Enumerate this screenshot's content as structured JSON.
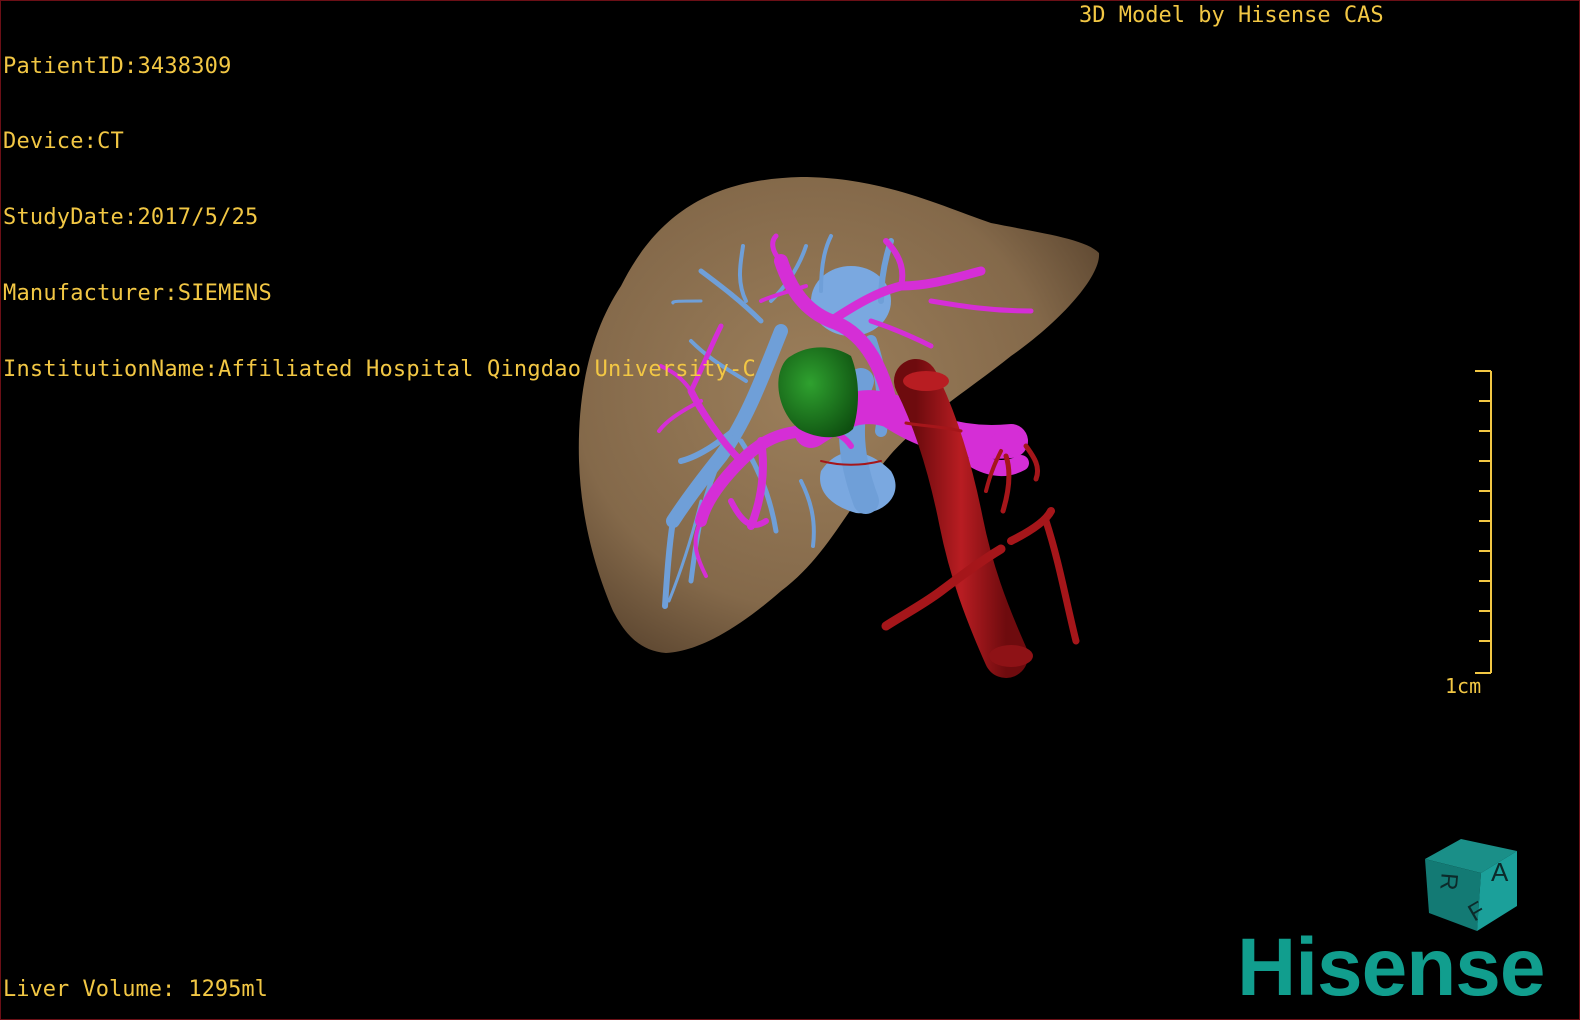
{
  "overlay": {
    "patient_id": "PatientID:3438309",
    "device": "Device:CT",
    "study_date": "StudyDate:2017/5/25",
    "manufacturer": "Manufacturer:SIEMENS",
    "institution": "InstitutionName:Affiliated Hospital Qingdao University-C"
  },
  "header": {
    "brand_label": "3D Model by Hisense CAS"
  },
  "footer": {
    "liver_volume": "Liver Volume: 1295ml"
  },
  "scale_bar": {
    "label": "1cm"
  },
  "orientation_cube": {
    "faces": [
      "A",
      "R",
      "F"
    ]
  },
  "logo": {
    "text": "Hisense"
  },
  "colors": {
    "overlay_text": "#f2c744",
    "liver": "#8a7050",
    "portal_vein": "#d52ed6",
    "hepatic_vein": "#6f9fd8",
    "lesion": "#1d7a1f",
    "artery": "#a5161a",
    "brand": "#119e8e",
    "frame": "#6b0f16"
  }
}
